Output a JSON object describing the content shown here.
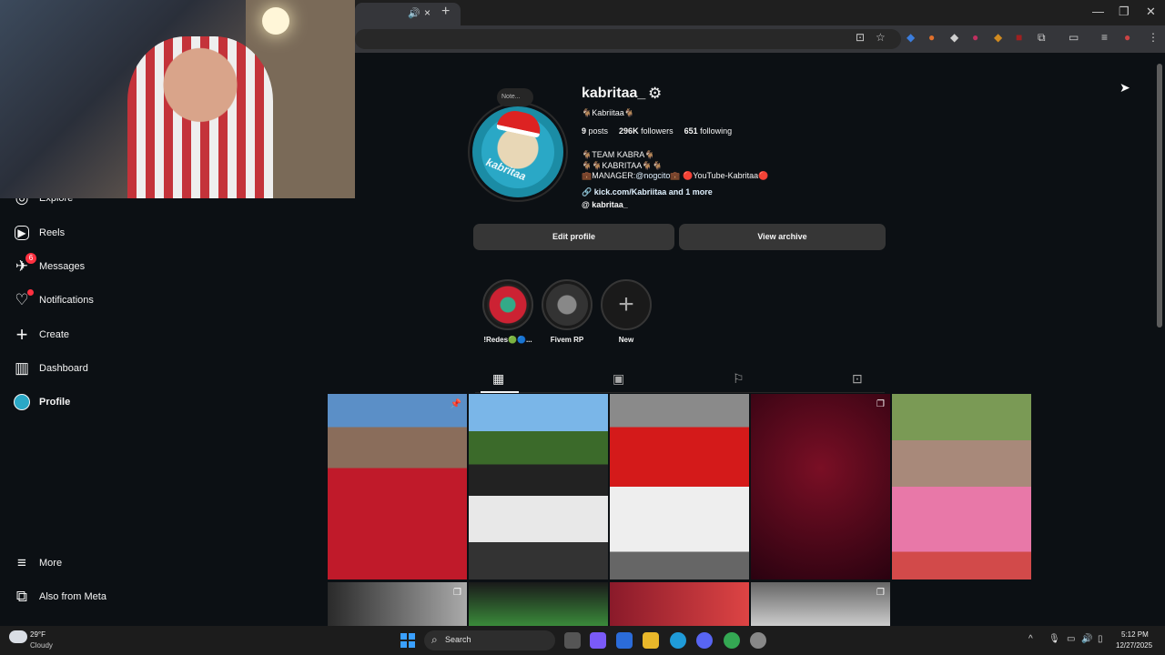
{
  "browser": {
    "tab_speaker": "🔊",
    "tab_close": "×",
    "new_tab": "+",
    "window_controls": {
      "minimize": "—",
      "maximize": "❐",
      "close": "✕"
    }
  },
  "sidebar": {
    "items": [
      {
        "label": "Explore",
        "icon": "◎"
      },
      {
        "label": "Reels",
        "icon": "▶"
      },
      {
        "label": "Messages",
        "icon": "✈",
        "badge": "6"
      },
      {
        "label": "Notifications",
        "icon": "♡"
      },
      {
        "label": "Create",
        "icon": "+"
      },
      {
        "label": "Dashboard",
        "icon": "▥"
      },
      {
        "label": "Profile",
        "icon": ""
      },
      {
        "label": "More",
        "icon": "≡"
      },
      {
        "label": "Also from Meta",
        "icon": "⧉"
      }
    ]
  },
  "profile": {
    "note": "Note...",
    "avatar_text": "kabritaa",
    "username": "kabritaa_",
    "display_name": "🐐Kabriitaa🐐",
    "stats": {
      "posts": "9",
      "posts_label": "posts",
      "followers": "296K",
      "followers_label": "followers",
      "following": "651",
      "following_label": "following"
    },
    "bio": {
      "line1": "🐐TEAM KABRA🐐",
      "line2": "🐐🐐KABRITAA🐐🐐",
      "line3_prefix": "💼MANAGER:",
      "line3_mention": "@nogcito",
      "line3_suffix": "💼 🔴YouTube-Kabritaa🔴"
    },
    "link": "kick.com/Kabriitaa and 1 more",
    "threads": "kabritaa_",
    "edit_profile": "Edit profile",
    "view_archive": "View archive"
  },
  "highlights": [
    {
      "label": "!Redes🟢🔵..."
    },
    {
      "label": "Fivem RP"
    },
    {
      "label": "New"
    }
  ],
  "taskbar": {
    "weather_temp": "29°F",
    "weather_desc": "Cloudy",
    "search": "Search",
    "time": "5:12 PM",
    "date": "12/27/2025"
  }
}
